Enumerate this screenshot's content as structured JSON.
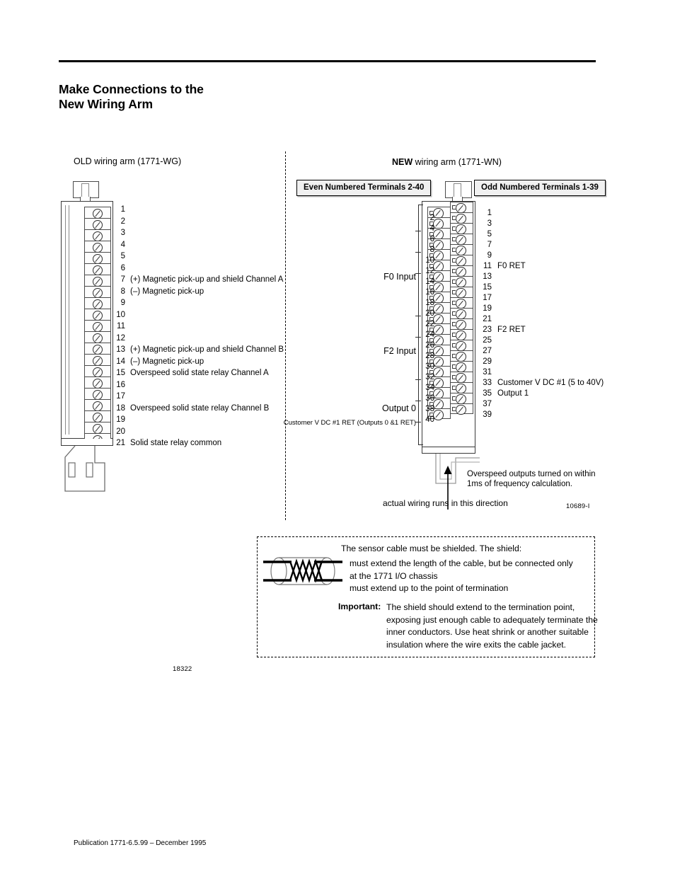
{
  "document": {
    "title_line1": "Make Connections to the",
    "title_line2": "New Wiring Arm",
    "footer": "Publication 1771-6.5.99 – December 1995"
  },
  "old_arm": {
    "caption": "OLD wiring arm (1771-WG)",
    "figure_id": "18322",
    "terminals": [
      {
        "num": "1",
        "label": ""
      },
      {
        "num": "2",
        "label": ""
      },
      {
        "num": "3",
        "label": ""
      },
      {
        "num": "4",
        "label": ""
      },
      {
        "num": "5",
        "label": ""
      },
      {
        "num": "6",
        "label": ""
      },
      {
        "num": "7",
        "label": "(+) Magnetic pick-up and shield Channel A"
      },
      {
        "num": "8",
        "label": "(–) Magnetic pick-up"
      },
      {
        "num": "9",
        "label": ""
      },
      {
        "num": "10",
        "label": ""
      },
      {
        "num": "11",
        "label": ""
      },
      {
        "num": "12",
        "label": ""
      },
      {
        "num": "13",
        "label": "(+) Magnetic pick-up and shield Channel B"
      },
      {
        "num": "14",
        "label": "(–) Magnetic pick-up"
      },
      {
        "num": "15",
        "label": "Overspeed solid state relay Channel A"
      },
      {
        "num": "16",
        "label": ""
      },
      {
        "num": "17",
        "label": ""
      },
      {
        "num": "18",
        "label": "Overspeed solid state relay Channel B"
      },
      {
        "num": "19",
        "label": ""
      },
      {
        "num": "20",
        "label": ""
      },
      {
        "num": "21",
        "label": "Solid state relay common"
      }
    ]
  },
  "new_arm": {
    "caption_bold": "NEW",
    "caption_rest": " wiring arm  (1771-WN)",
    "header_even": "Even Numbered Terminals 2-40",
    "header_odd": "Odd Numbered Terminals 1-39",
    "figure_id": "10689-I",
    "even_terminals": [
      "2",
      "4",
      "6",
      "8",
      "10",
      "12",
      "14",
      "16",
      "18",
      "20",
      "22",
      "24",
      "26",
      "28",
      "30",
      "32",
      "34",
      "36",
      "38",
      "40"
    ],
    "odd_terminals": [
      {
        "num": "1",
        "label": ""
      },
      {
        "num": "3",
        "label": ""
      },
      {
        "num": "5",
        "label": ""
      },
      {
        "num": "7",
        "label": ""
      },
      {
        "num": "9",
        "label": ""
      },
      {
        "num": "11",
        "label": "F0 RET"
      },
      {
        "num": "13",
        "label": ""
      },
      {
        "num": "15",
        "label": ""
      },
      {
        "num": "17",
        "label": ""
      },
      {
        "num": "19",
        "label": ""
      },
      {
        "num": "21",
        "label": ""
      },
      {
        "num": "23",
        "label": "F2 RET"
      },
      {
        "num": "25",
        "label": ""
      },
      {
        "num": "27",
        "label": ""
      },
      {
        "num": "29",
        "label": ""
      },
      {
        "num": "31",
        "label": ""
      },
      {
        "num": "33",
        "label": "Customer V DC #1 (5 to 40V)"
      },
      {
        "num": "35",
        "label": "Output 1"
      },
      {
        "num": "37",
        "label": ""
      },
      {
        "num": "39",
        "label": ""
      }
    ],
    "group_labels": {
      "f0_input": "F0 Input",
      "f2_input": "F2 Input",
      "output_0": "Output 0",
      "customer_ret": "Customer V DC #1 RET (Outputs 0 &1 RET)"
    },
    "annotations": {
      "overspeed_line1": "Overspeed outputs turned on within",
      "overspeed_line2": "1ms of frequency calculation.",
      "direction": "actual wiring runs in this direction"
    }
  },
  "note": {
    "intro": "The sensor cable must be shielded.  The shield:",
    "bullets": [
      "must extend the length of the cable, but be connected only",
      "at the 1771 I/O chassis",
      "must extend up to the point of termination"
    ],
    "important_label": "Important:",
    "important_lines": [
      "The shield should extend to the termination point,",
      "exposing just enough cable to adequately terminate the",
      "inner conductors.  Use heat shrink or another suitable",
      "insulation where the wire exits the cable jacket."
    ]
  }
}
